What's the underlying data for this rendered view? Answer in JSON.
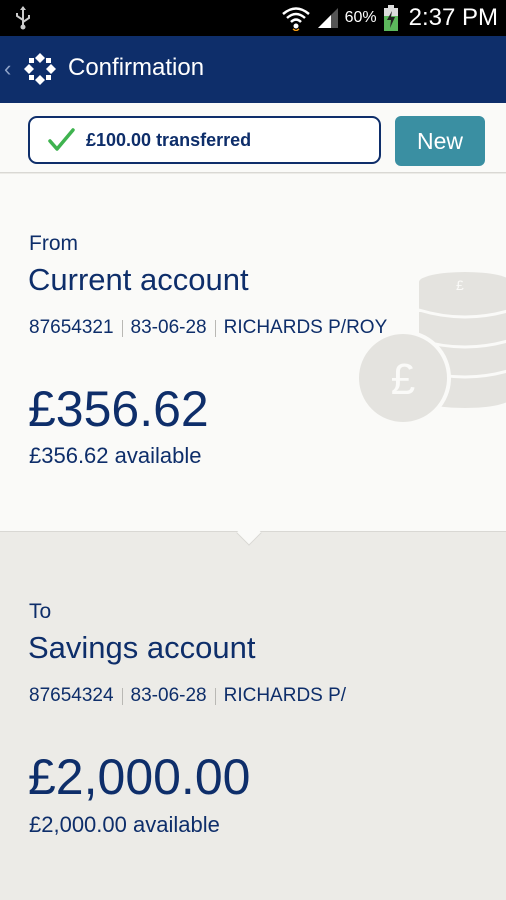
{
  "status_bar": {
    "battery_percent": "60%",
    "time": "2:37 PM"
  },
  "header": {
    "title": "Confirmation"
  },
  "confirmation": {
    "message": "£100.00 transferred",
    "new_button_label": "New"
  },
  "from_account": {
    "label": "From",
    "name": "Current account",
    "account_number": "87654321",
    "sort_code": "83-06-28",
    "holder": "RICHARDS P/ROY",
    "balance": "£356.62",
    "available": "£356.62 available"
  },
  "to_account": {
    "label": "To",
    "name": "Savings account",
    "account_number": "87654324",
    "sort_code": "83-06-28",
    "holder": "RICHARDS P/",
    "balance": "£2,000.00",
    "available": "£2,000.00 available"
  },
  "colors": {
    "brand_navy": "#0e2e6a",
    "accent_teal": "#3a8fa2",
    "success_green": "#3fb34f"
  }
}
